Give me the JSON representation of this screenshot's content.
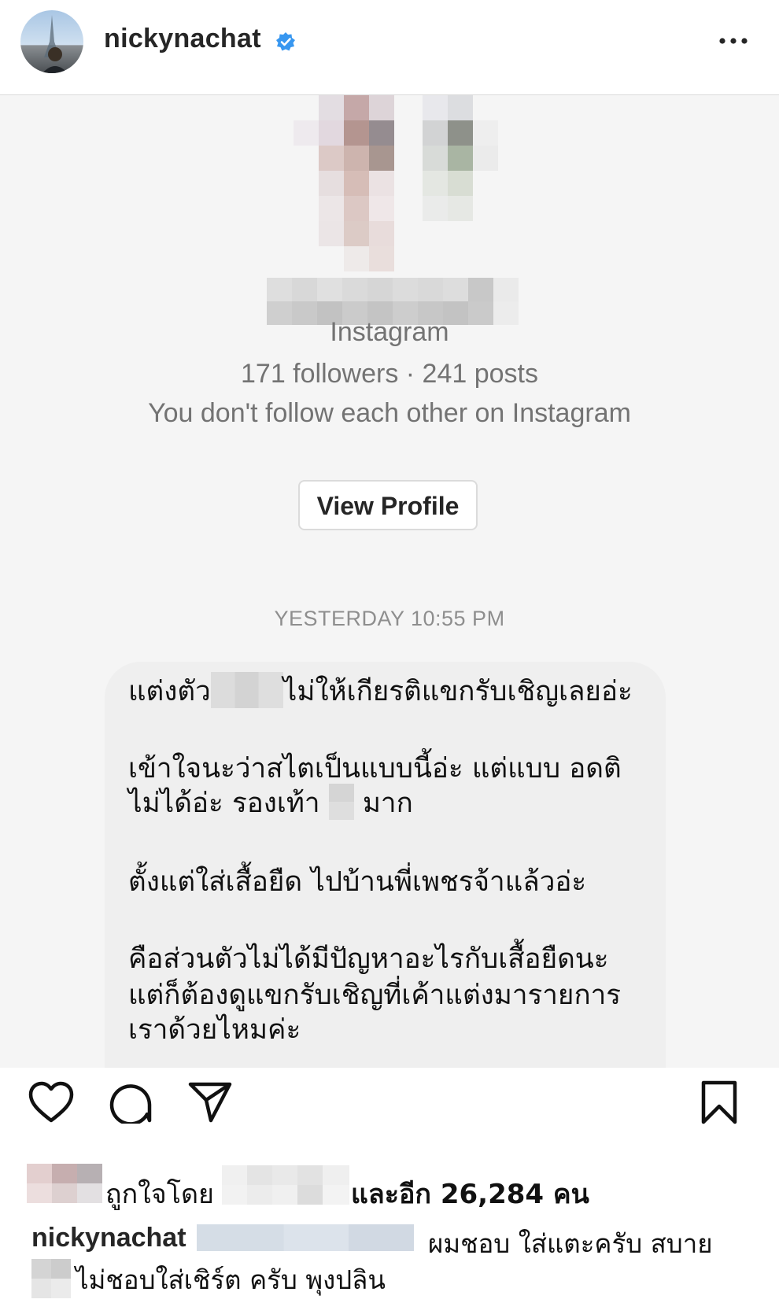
{
  "header": {
    "username": "nickynachat",
    "verified": true,
    "more_icon": "more-horizontal-icon"
  },
  "post": {
    "shared_profile": {
      "source": "Instagram",
      "stats": "171 followers · 241 posts",
      "relationship": "You don't follow each other on Instagram",
      "view_button": "View Profile"
    },
    "timestamp": "YESTERDAY 10:55 PM",
    "message_lines": [
      {
        "segments": [
          "แต่งตัว",
          "ไม่ให้เกียรติแขกรับเชิญเลยอ่ะ"
        ]
      },
      {
        "segments": [
          "เข้าใจนะว่าสไตเป็นแบบนี้อ่ะ แต่แบบ อดติ"
        ]
      },
      {
        "segments": [
          "ไม่ได้อ่ะ รองเท้า",
          "มาก"
        ]
      },
      {
        "segments": [
          "ตั้งแต่ใส่เสื้อยืด ไปบ้านพี่เพชรจ้าแล้วอ่ะ"
        ]
      },
      {
        "segments": [
          "คือส่วนตัวไม่ได้มีปัญหาอะไรกับเสื้อยืดนะ"
        ]
      },
      {
        "segments": [
          "แต่ก็ต้องดูแขกรับเชิญที่เค้าแต่งมารายการ"
        ]
      },
      {
        "segments": [
          "เราด้วยไหมค่ะ"
        ]
      }
    ]
  },
  "actions": {
    "like_icon": "heart-icon",
    "comment_icon": "comment-icon",
    "share_icon": "send-icon",
    "save_icon": "bookmark-icon"
  },
  "likes": {
    "prefix": "ถูกใจโดย",
    "suffix": "และอีก 26,284 คน"
  },
  "comment": {
    "username": "nickynachat",
    "line1": "ผมชอบ ใส่แตะครับ สบาย",
    "line2": "ไม่ชอบใส่เชิร์ต ครับ พุงปลิน"
  },
  "colors": {
    "verified": "#3897f0",
    "bubble": "#efefef",
    "muted_text": "#737373",
    "divider": "#dbdbdb"
  }
}
